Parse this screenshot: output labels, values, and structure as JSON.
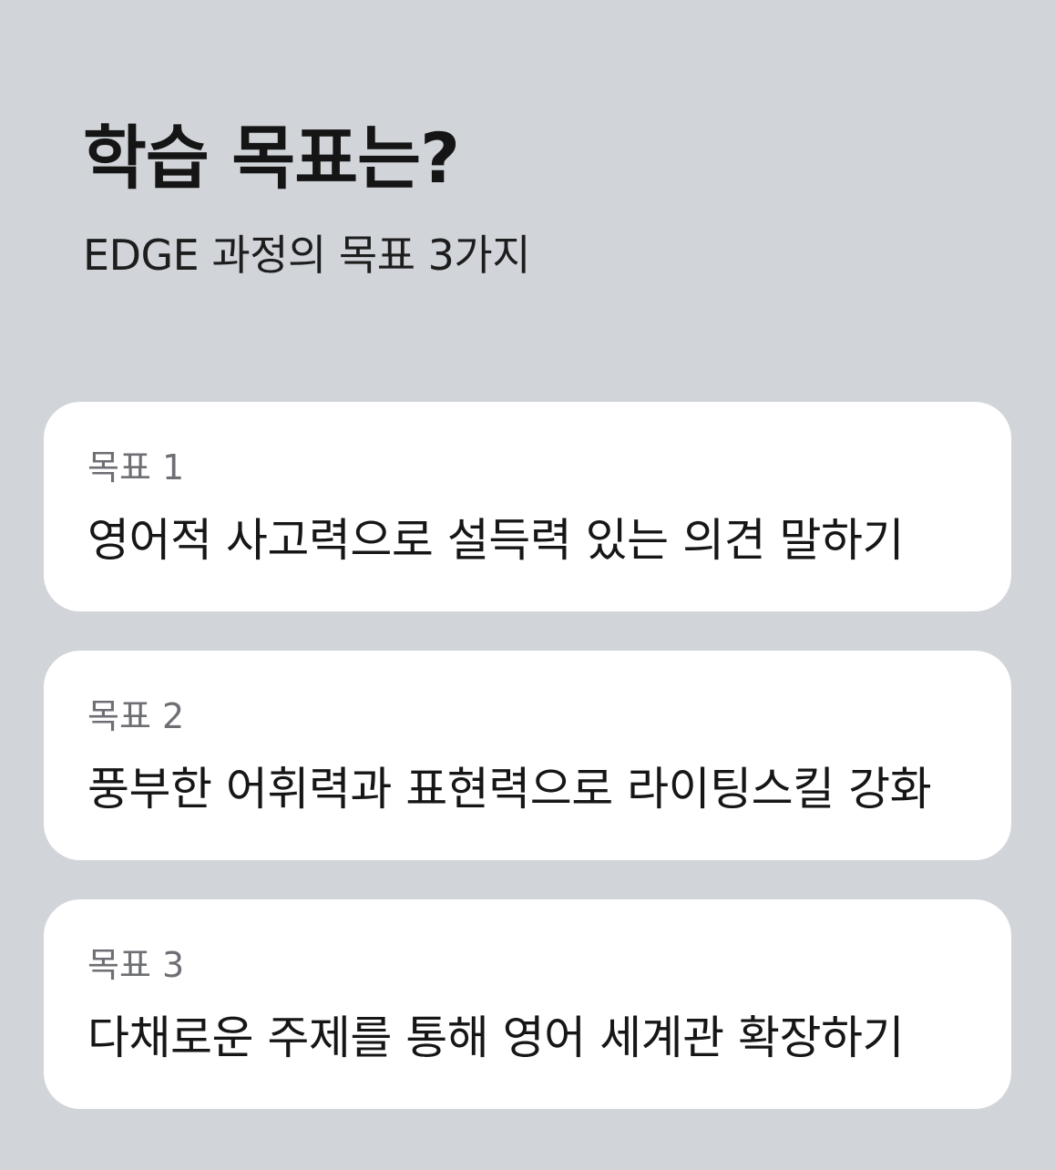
{
  "header": {
    "title": "학습 목표는?",
    "subtitle": "EDGE 과정의 목표 3가지"
  },
  "goals": [
    {
      "label": "목표 1",
      "text": "영어적 사고력으로 설득력 있는 의견 말하기"
    },
    {
      "label": "목표 2",
      "text": "풍부한 어휘력과 표현력으로 라이팅스킬 강화"
    },
    {
      "label": "목표 3",
      "text": "다채로운 주제를 통해 영어 세계관 확장하기"
    }
  ],
  "colors": {
    "background": "#d1d4d9",
    "card": "#ffffff",
    "label": "#6e6f74",
    "text": "#161616"
  }
}
